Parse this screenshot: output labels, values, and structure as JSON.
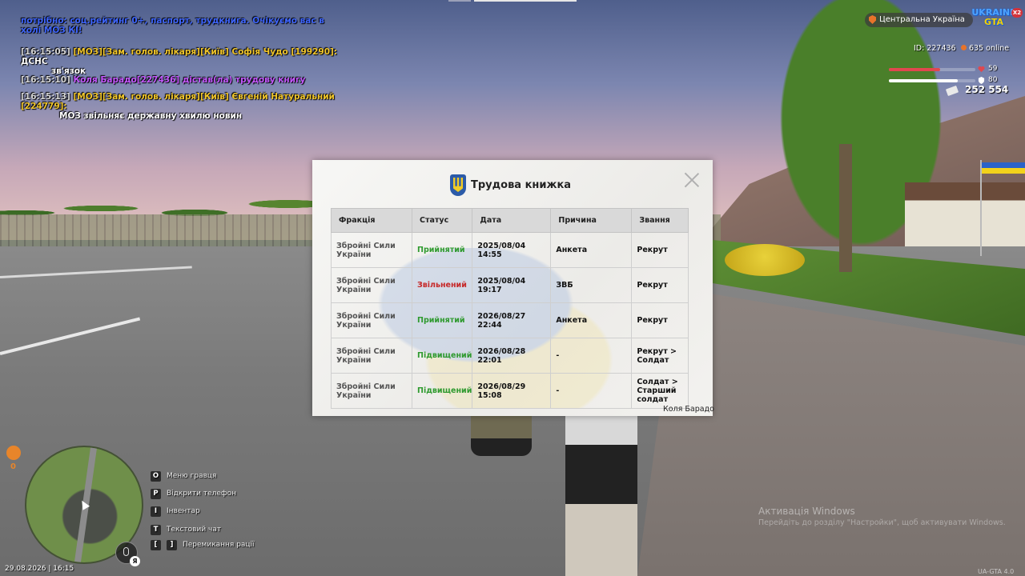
{
  "chat": [
    {
      "lines": [
        [
          {
            "text": "потрібно: соц.рейтинг 0+, паспорт, трудкнига. Очікуємо вас в",
            "color": "blue"
          }
        ],
        [
          {
            "text": "холі МОЗ КІ!",
            "color": "blue"
          }
        ]
      ]
    },
    {
      "lines": [
        [
          {
            "text": "[16:15:05] ",
            "color": "ts"
          },
          {
            "text": "[МОЗ][Зам. голов. лікаря][Київ] Софія Чудо [199290]: ",
            "color": "yellow"
          },
          {
            "text": "ДСНС",
            "color": "white"
          }
        ],
        [
          {
            "text": "зв'язок",
            "color": "white"
          }
        ]
      ]
    },
    {
      "lines": [
        [
          {
            "text": "[16:15:10] ",
            "color": "ts"
          },
          {
            "text": "Коля Барадо[227436] дістав(ла) трудову книгу",
            "color": "purple"
          }
        ]
      ]
    },
    {
      "lines": [
        [
          {
            "text": "[16:15:13] ",
            "color": "ts"
          },
          {
            "text": "[МОЗ][Зам. голов. лікаря][Київ] Євгеній Натуральний [224779]:",
            "color": "yellow"
          }
        ],
        [
          {
            "text": "МОЗ звільняє державну хвилю новин",
            "color": "white"
          }
        ]
      ]
    }
  ],
  "hud": {
    "region": "Центральна Україна",
    "logo_top": "UKRAINE",
    "logo_bottom": "GTA",
    "logo_badge": "X2",
    "player_id": "ID: 227436",
    "online": "635 online",
    "health": 59,
    "armor": 80,
    "money": "252 554",
    "health_color": "#e0484f",
    "armor_color": "#ffffff"
  },
  "modal": {
    "title": "Трудова книжка",
    "columns": [
      "Фракція",
      "Статус",
      "Дата",
      "Причина",
      "Звання"
    ],
    "rows": [
      {
        "faction": "Збройні Сили України",
        "status": "Прийнятий",
        "status_type": "green",
        "date": "2025/08/04 14:55",
        "reason": "Анкета",
        "rank": "Рекрут"
      },
      {
        "faction": "Збройні Сили України",
        "status": "Звільнений",
        "status_type": "red",
        "date": "2025/08/04 19:17",
        "reason": "ЗВБ",
        "rank": "Рекрут"
      },
      {
        "faction": "Збройні Сили України",
        "status": "Прийнятий",
        "status_type": "green",
        "date": "2026/08/27 22:44",
        "reason": "Анкета",
        "rank": "Рекрут"
      },
      {
        "faction": "Збройні Сили України",
        "status": "Підвищений",
        "status_type": "green",
        "date": "2026/08/28 22:01",
        "reason": "-",
        "rank": "Рекрут > Солдат"
      },
      {
        "faction": "Збройні Сили України",
        "status": "Підвищений",
        "status_type": "green",
        "date": "2026/08/29 15:08",
        "reason": "-",
        "rank": "Солдат > Старший солдат"
      }
    ],
    "owner": "Коля Барадо"
  },
  "minimap": {
    "hunger_value": "0",
    "mic_lang": "Я"
  },
  "datetime": "29.08.2026 | 16:15",
  "hints": [
    {
      "key": "O",
      "label": "Меню гравця"
    },
    {
      "key": "P",
      "label": "Відкрити телефон"
    },
    {
      "key": "I",
      "label": "Інвентар"
    },
    {
      "key": "T",
      "label": "Текстовий чат"
    },
    {
      "key": "[",
      "key2": "]",
      "label": "Перемикання рації"
    }
  ],
  "watermark": {
    "title": "Активація Windows",
    "subtitle": "Перейдіть до розділу \"Настройки\", щоб активувати Windows."
  },
  "version": "UA-GTA 4.0"
}
